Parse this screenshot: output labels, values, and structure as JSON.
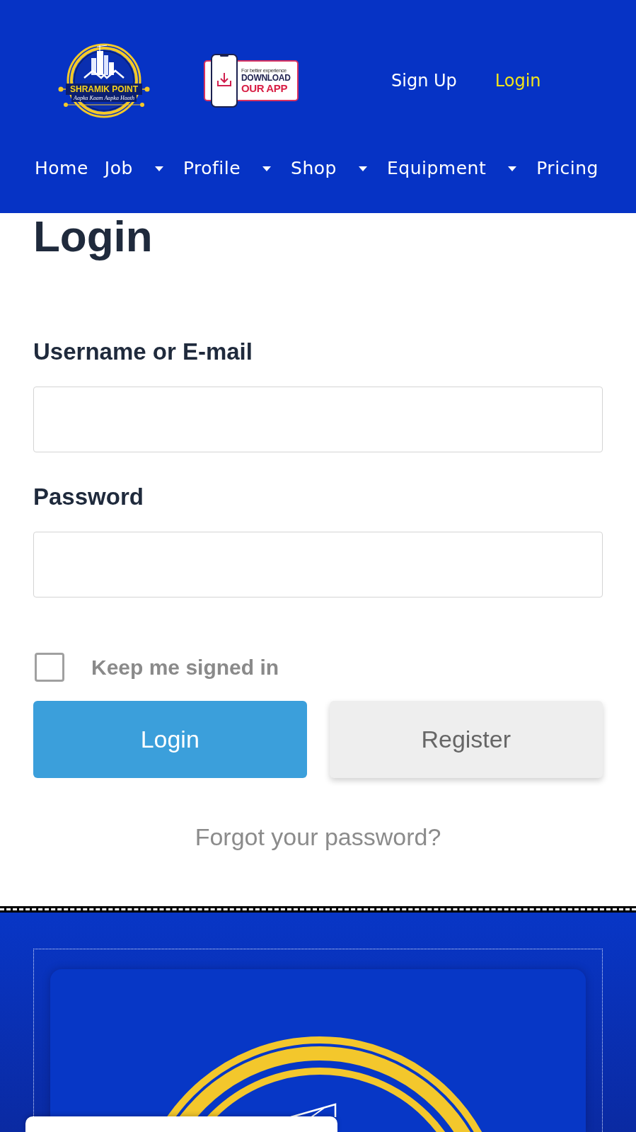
{
  "header": {
    "logo": {
      "title": "SHRAMIK POINT",
      "tagline": "Aapka Kaam Aapka Haath"
    },
    "app_badge": {
      "caption": "For better experience",
      "line_1": "DOWNLOAD",
      "line_2": "OUR APP"
    },
    "auth_links": [
      {
        "label": "Sign Up",
        "selected": false
      },
      {
        "label": "Login",
        "selected": true
      }
    ],
    "nav": [
      {
        "label": "Home",
        "has_submenu": false
      },
      {
        "label": "Job",
        "has_submenu": true
      },
      {
        "label": "Profile",
        "has_submenu": true
      },
      {
        "label": "Shop",
        "has_submenu": true
      },
      {
        "label": "Equipment",
        "has_submenu": true
      },
      {
        "label": "Pricing",
        "has_submenu": false
      }
    ]
  },
  "form": {
    "heading": "Login",
    "fields": [
      {
        "label": "Username or E-mail"
      },
      {
        "label": "Password"
      }
    ],
    "remember": {
      "label": "Keep me signed in",
      "checked": false
    },
    "buttons": [
      {
        "label": "Login",
        "kind": "primary"
      },
      {
        "label": "Register",
        "kind": "secondary"
      }
    ],
    "forgot_link": "Forgot your password?"
  }
}
